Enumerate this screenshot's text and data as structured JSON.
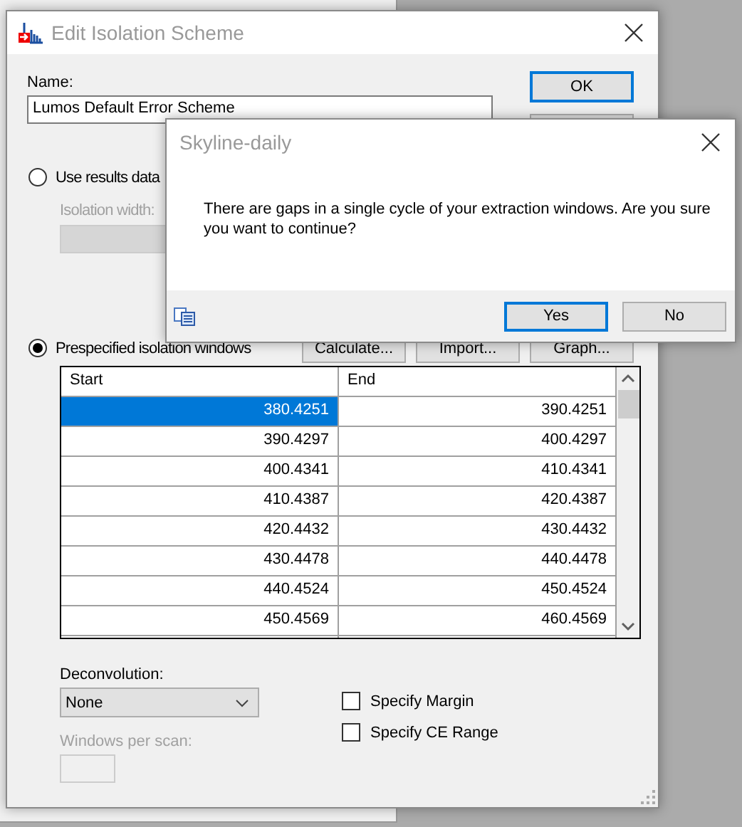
{
  "main_dialog": {
    "title": "Edit Isolation Scheme",
    "name_label": "Name:",
    "name_value": "Lumos Default Error Scheme",
    "side_buttons": [
      {
        "label": "OK",
        "focused": true
      }
    ],
    "options": [
      {
        "label": "Use results data",
        "selected": false
      },
      {
        "label": "Prespecified isolation windows",
        "selected": true
      }
    ],
    "isolation_width": {
      "label": "Isolation width:",
      "disabled": true
    },
    "window_buttons": [
      "Calculate...",
      "Import...",
      "Graph..."
    ],
    "table": {
      "columns": [
        "Start",
        "End"
      ],
      "rows": [
        {
          "start": "380.4251",
          "end": "390.4251",
          "selected": true
        },
        {
          "start": "390.4297",
          "end": "400.4297",
          "selected": false
        },
        {
          "start": "400.4341",
          "end": "410.4341",
          "selected": false
        },
        {
          "start": "410.4387",
          "end": "420.4387",
          "selected": false
        },
        {
          "start": "420.4432",
          "end": "430.4432",
          "selected": false
        },
        {
          "start": "430.4478",
          "end": "440.4478",
          "selected": false
        },
        {
          "start": "440.4524",
          "end": "450.4524",
          "selected": false
        },
        {
          "start": "450.4569",
          "end": "460.4569",
          "selected": false
        }
      ]
    },
    "deconvolution": {
      "label": "Deconvolution:",
      "value": "None"
    },
    "windows_per_scan": {
      "label": "Windows per scan:",
      "disabled": true
    },
    "checkboxes": [
      {
        "label": "Specify Margin",
        "checked": false
      },
      {
        "label": "Specify CE Range",
        "checked": false
      }
    ]
  },
  "message_box": {
    "title": "Skyline-daily",
    "message": "There are gaps in a single cycle of your extraction windows. Are you sure you want to continue?",
    "buttons": [
      {
        "label": "Yes",
        "focused": true
      },
      {
        "label": "No",
        "focused": false
      }
    ]
  }
}
